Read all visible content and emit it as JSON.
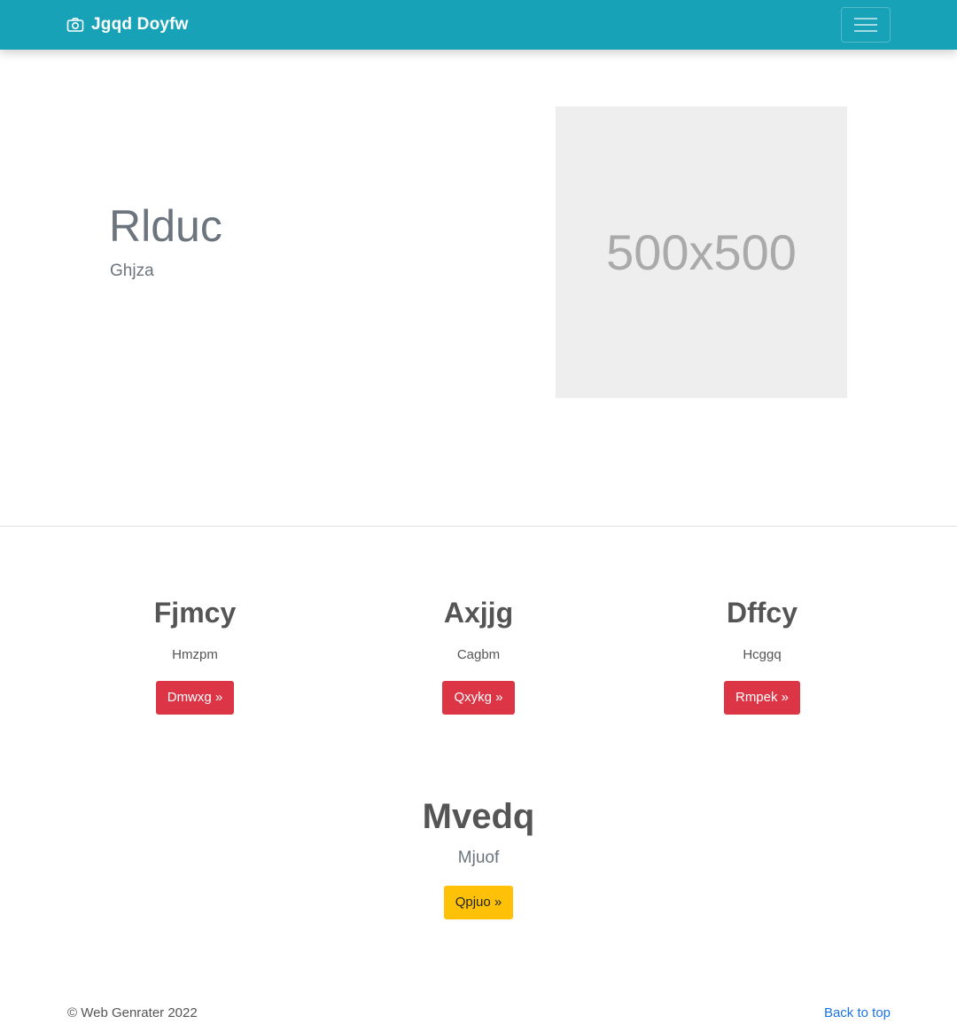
{
  "navbar": {
    "brand_icon": "camera-icon",
    "brand": "Jgqd Doyfw",
    "toggler_icon": "hamburger-menu-icon",
    "background": "#17a2b8"
  },
  "hero": {
    "title": "Rlduc",
    "subtitle": "Ghjza",
    "placeholder_text": "500x500"
  },
  "features": [
    {
      "title": "Fjmcy",
      "text": "Hmzpm",
      "button": "Dmwxg »",
      "button_color": "#dc3545"
    },
    {
      "title": "Axjjg",
      "text": "Cagbm",
      "button": "Qxykg »",
      "button_color": "#dc3545"
    },
    {
      "title": "Dffcy",
      "text": "Hcggq",
      "button": "Rmpek »",
      "button_color": "#dc3545"
    }
  ],
  "cta": {
    "title": "Mvedq",
    "text": "Mjuof",
    "button": "Qpjuo »",
    "button_color": "#ffc107"
  },
  "footer": {
    "copyright": "© Web Genrater 2022",
    "back_to_top": "Back to top"
  }
}
